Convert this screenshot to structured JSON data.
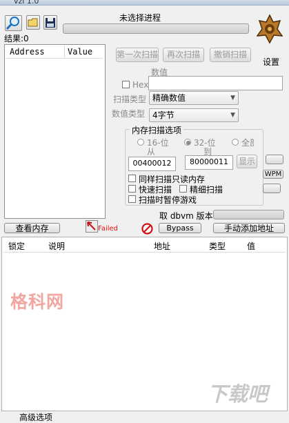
{
  "window": {
    "title": "vzl 1.0"
  },
  "toolbar": {
    "process_status": "未选择进程",
    "settings_label": "设置"
  },
  "results": {
    "label": "结果:0"
  },
  "address_list": {
    "columns": [
      "Address",
      "Value"
    ]
  },
  "scan": {
    "first_scan": "第一次扫描",
    "next_scan": "再次扫描",
    "undo_scan": "撤销扫描",
    "value_label": "数值",
    "hex_label": "Hex",
    "scan_type_label": "扫描类型",
    "scan_type_value": "精确数值",
    "value_type_label": "数值类型",
    "value_type_value": "4字节"
  },
  "mem_options": {
    "title": "内存扫描选项",
    "radio_16": "16-位",
    "radio_32": "32-位",
    "radio_all": "全部",
    "from_label": "从",
    "to_label": "到",
    "from_value": "00400012",
    "to_value": "80000011",
    "show_btn": "显示",
    "readonly_label": "同样扫描只读内存",
    "fast_label": "快速扫描",
    "fine_label": "精细扫描",
    "pause_label": "扫描时暂停游戏"
  },
  "side": {
    "wpm": "WPM"
  },
  "dbvm": {
    "label": "取 dbvm 版本"
  },
  "bottom_bar": {
    "view_memory": "查看内存",
    "failed": "Failed",
    "bypass": "Bypass",
    "add_address": "手动添加地址"
  },
  "table": {
    "columns": [
      "锁定",
      "说明",
      "地址",
      "类型",
      "值"
    ]
  },
  "watermarks": {
    "left": "格科网",
    "right": "下载吧"
  },
  "footer": {
    "advanced": "高级选项"
  },
  "colors": {
    "failed": "#e01010",
    "watermark": "#f2a6a0"
  }
}
